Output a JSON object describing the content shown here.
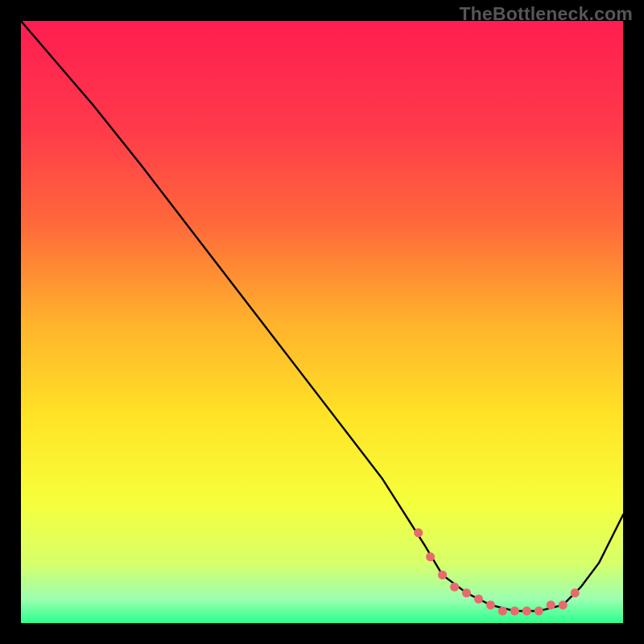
{
  "watermark": "TheBottleneck.com",
  "colors": {
    "gradient_stops": [
      {
        "offset": 0.0,
        "color": "#ff1d50"
      },
      {
        "offset": 0.18,
        "color": "#ff3a4a"
      },
      {
        "offset": 0.34,
        "color": "#ff6a3a"
      },
      {
        "offset": 0.5,
        "color": "#ffb22c"
      },
      {
        "offset": 0.66,
        "color": "#ffe426"
      },
      {
        "offset": 0.8,
        "color": "#f6ff3c"
      },
      {
        "offset": 0.9,
        "color": "#d7ff6a"
      },
      {
        "offset": 0.96,
        "color": "#9cffb0"
      },
      {
        "offset": 1.0,
        "color": "#2cff8f"
      }
    ],
    "curve": "#000000",
    "dots": "#e86a6d",
    "frame": "#000000"
  },
  "chart_data": {
    "type": "line",
    "title": "",
    "xlabel": "",
    "ylabel": "",
    "xlim": [
      0,
      100
    ],
    "ylim": [
      0,
      100
    ],
    "grid": false,
    "legend": false,
    "series": [
      {
        "name": "bottleneck-curve",
        "x": [
          0,
          6,
          12,
          20,
          30,
          40,
          50,
          60,
          67,
          70,
          74,
          78,
          82,
          86,
          90,
          93,
          96,
          100
        ],
        "y": [
          100,
          93,
          86,
          76,
          63,
          50,
          37,
          24,
          13,
          8,
          5,
          3,
          2,
          2,
          3,
          6,
          10,
          18
        ]
      }
    ],
    "markers": {
      "name": "highlight-dots",
      "x": [
        66,
        68,
        70,
        72,
        74,
        76,
        78,
        80,
        82,
        84,
        86,
        88,
        90,
        92
      ],
      "y": [
        15,
        11,
        8,
        6,
        5,
        4,
        3,
        2,
        2,
        2,
        2,
        3,
        3,
        5
      ]
    }
  }
}
